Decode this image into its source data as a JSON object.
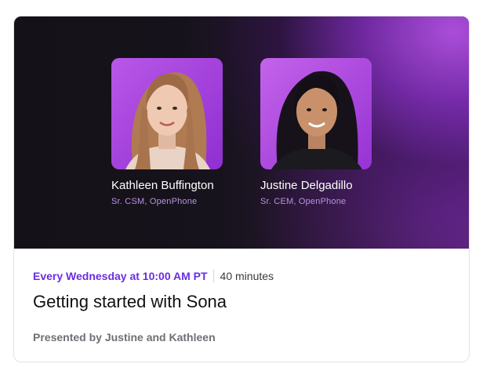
{
  "webinar": {
    "presenters": [
      {
        "name": "Kathleen Buffington",
        "role": "Sr. CSM, OpenPhone"
      },
      {
        "name": "Justine Delgadillo",
        "role": "Sr. CEM, OpenPhone"
      }
    ],
    "schedule": "Every Wednesday at 10:00 AM PT",
    "duration": "40 minutes",
    "title": "Getting started with Sona",
    "presented_by": "Presented by Justine and Kathleen"
  },
  "colors": {
    "accent": "#6a2ee0",
    "banner_dark": "#141118",
    "banner_purple": "#b050e0",
    "role_text": "#b892e0"
  }
}
